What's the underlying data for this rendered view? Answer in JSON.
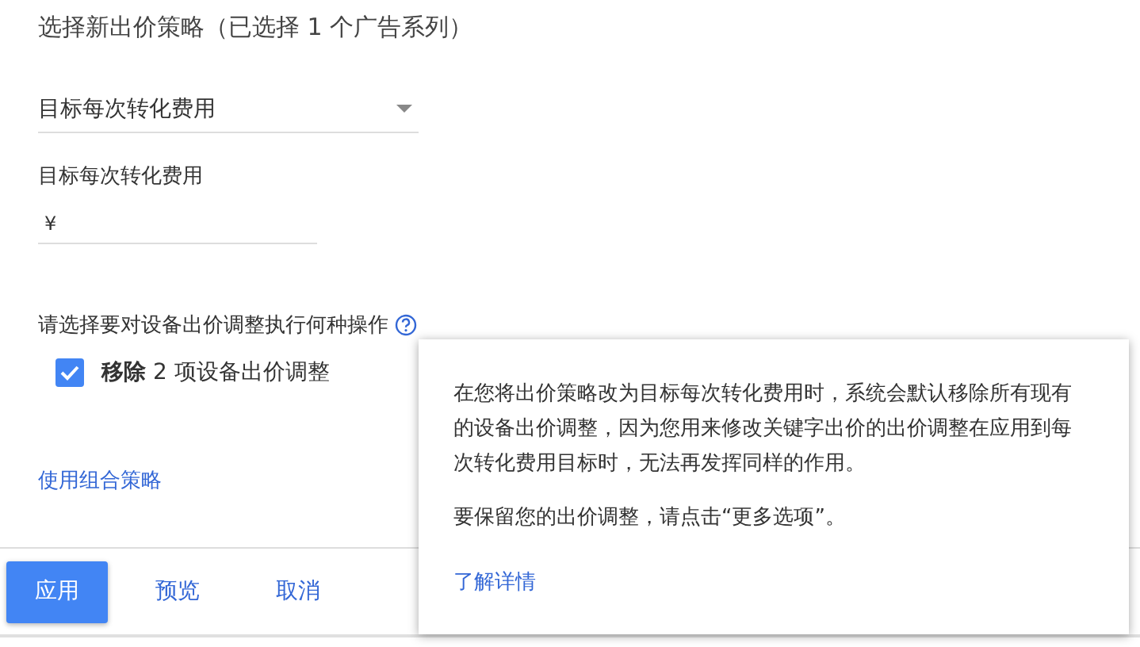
{
  "title": "选择新出价策略（已选择 1 个广告系列）",
  "strategy_select": {
    "value": "目标每次转化费用"
  },
  "target_field": {
    "label": "目标每次转化费用",
    "prefix": "¥"
  },
  "device_question": "请选择要对设备出价调整执行何种操作",
  "remove_option": {
    "label": "**移除** 2 项设备出价调整",
    "checked": true
  },
  "portfolio_link": "使用组合策略",
  "buttons": [
    {
      "label": "应用",
      "kind": "primary"
    },
    {
      "label": "预览",
      "kind": "text"
    },
    {
      "label": "取消",
      "kind": "text"
    }
  ],
  "tooltip": {
    "paragraphs": [
      "在您将出价策略改为目标每次转化费用时，系统会默认移除所有现有的设备出价调整，因为您用来修改关键字出价的出价调整在应用到每次转化费用目标时，无法再发挥同样的作用。",
      "要保留您的出价调整，请点击“更多选项”。"
    ],
    "link": "了解详情"
  }
}
